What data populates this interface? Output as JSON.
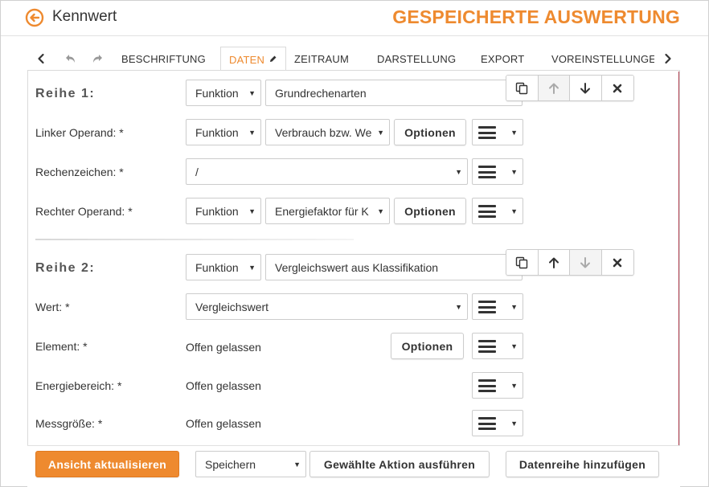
{
  "header": {
    "back_label": "Kennwert",
    "title": "GESPEICHERTE AUSWERTUNG",
    "accent_color": "#ee8a2f"
  },
  "tabs": {
    "icons": [
      "chevron-left-icon",
      "undo-icon",
      "redo-icon",
      "chevron-right-icon"
    ],
    "items": [
      {
        "label": "BESCHRIFTUNG"
      },
      {
        "label": "DATEN"
      },
      {
        "label": "ZEITRAUM"
      },
      {
        "label": "DARSTELLUNG"
      },
      {
        "label": "EXPORT"
      },
      {
        "label": "VOREINSTELLUNGEN"
      }
    ],
    "active_tab": "DATEN"
  },
  "reihe1": {
    "heading": "Reihe 1:",
    "type": "Funktion",
    "function": "Grundrechenarten",
    "linker": {
      "label": "Linker Operand:",
      "type": "Funktion",
      "value": "Verbrauch bzw. Wert",
      "options": "Optionen"
    },
    "rechenzeichen": {
      "label": "Rechenzeichen:",
      "value": "/"
    },
    "rechter": {
      "label": "Rechter Operand:",
      "type": "Funktion",
      "value": "Energiefaktor für K",
      "options": "Optionen"
    }
  },
  "reihe2": {
    "heading": "Reihe 2:",
    "type": "Funktion",
    "function": "Vergleichswert aus Klassifikation",
    "wert": {
      "label": "Wert:",
      "value": "Vergleichswert"
    },
    "element": {
      "label": "Element:",
      "value": "Offen gelassen",
      "options": "Optionen"
    },
    "energiebereich": {
      "label": "Energiebereich:",
      "value": "Offen gelassen"
    },
    "messgroesse": {
      "label": "Messgröße:",
      "value": "Offen gelassen"
    }
  },
  "required_mark": "*",
  "footer": {
    "update_label": "Ansicht aktualisieren",
    "action_select": "Speichern",
    "execute_label": "Gewählte Aktion ausführen",
    "add_series_label": "Datenreihe hinzufügen"
  }
}
